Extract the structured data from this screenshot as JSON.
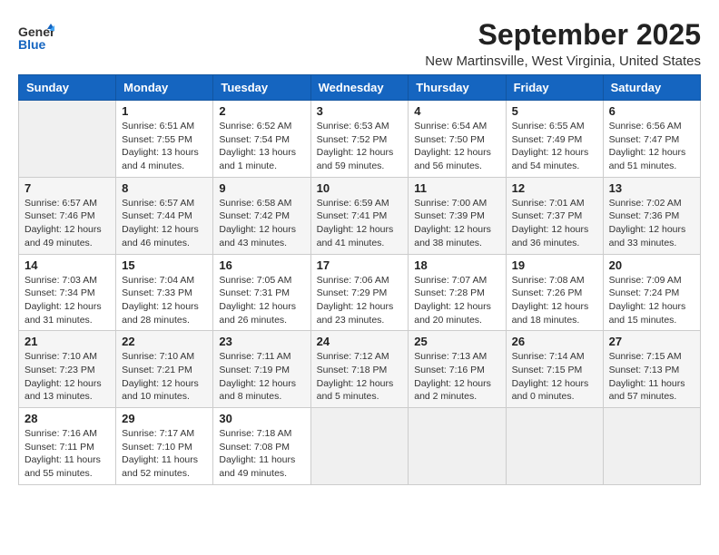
{
  "logo": {
    "text_general": "General",
    "text_blue": "Blue"
  },
  "title": "September 2025",
  "subtitle": "New Martinsville, West Virginia, United States",
  "days_of_week": [
    "Sunday",
    "Monday",
    "Tuesday",
    "Wednesday",
    "Thursday",
    "Friday",
    "Saturday"
  ],
  "weeks": [
    [
      {
        "day": "",
        "info": ""
      },
      {
        "day": "1",
        "info": "Sunrise: 6:51 AM\nSunset: 7:55 PM\nDaylight: 13 hours\nand 4 minutes."
      },
      {
        "day": "2",
        "info": "Sunrise: 6:52 AM\nSunset: 7:54 PM\nDaylight: 13 hours\nand 1 minute."
      },
      {
        "day": "3",
        "info": "Sunrise: 6:53 AM\nSunset: 7:52 PM\nDaylight: 12 hours\nand 59 minutes."
      },
      {
        "day": "4",
        "info": "Sunrise: 6:54 AM\nSunset: 7:50 PM\nDaylight: 12 hours\nand 56 minutes."
      },
      {
        "day": "5",
        "info": "Sunrise: 6:55 AM\nSunset: 7:49 PM\nDaylight: 12 hours\nand 54 minutes."
      },
      {
        "day": "6",
        "info": "Sunrise: 6:56 AM\nSunset: 7:47 PM\nDaylight: 12 hours\nand 51 minutes."
      }
    ],
    [
      {
        "day": "7",
        "info": "Sunrise: 6:57 AM\nSunset: 7:46 PM\nDaylight: 12 hours\nand 49 minutes."
      },
      {
        "day": "8",
        "info": "Sunrise: 6:57 AM\nSunset: 7:44 PM\nDaylight: 12 hours\nand 46 minutes."
      },
      {
        "day": "9",
        "info": "Sunrise: 6:58 AM\nSunset: 7:42 PM\nDaylight: 12 hours\nand 43 minutes."
      },
      {
        "day": "10",
        "info": "Sunrise: 6:59 AM\nSunset: 7:41 PM\nDaylight: 12 hours\nand 41 minutes."
      },
      {
        "day": "11",
        "info": "Sunrise: 7:00 AM\nSunset: 7:39 PM\nDaylight: 12 hours\nand 38 minutes."
      },
      {
        "day": "12",
        "info": "Sunrise: 7:01 AM\nSunset: 7:37 PM\nDaylight: 12 hours\nand 36 minutes."
      },
      {
        "day": "13",
        "info": "Sunrise: 7:02 AM\nSunset: 7:36 PM\nDaylight: 12 hours\nand 33 minutes."
      }
    ],
    [
      {
        "day": "14",
        "info": "Sunrise: 7:03 AM\nSunset: 7:34 PM\nDaylight: 12 hours\nand 31 minutes."
      },
      {
        "day": "15",
        "info": "Sunrise: 7:04 AM\nSunset: 7:33 PM\nDaylight: 12 hours\nand 28 minutes."
      },
      {
        "day": "16",
        "info": "Sunrise: 7:05 AM\nSunset: 7:31 PM\nDaylight: 12 hours\nand 26 minutes."
      },
      {
        "day": "17",
        "info": "Sunrise: 7:06 AM\nSunset: 7:29 PM\nDaylight: 12 hours\nand 23 minutes."
      },
      {
        "day": "18",
        "info": "Sunrise: 7:07 AM\nSunset: 7:28 PM\nDaylight: 12 hours\nand 20 minutes."
      },
      {
        "day": "19",
        "info": "Sunrise: 7:08 AM\nSunset: 7:26 PM\nDaylight: 12 hours\nand 18 minutes."
      },
      {
        "day": "20",
        "info": "Sunrise: 7:09 AM\nSunset: 7:24 PM\nDaylight: 12 hours\nand 15 minutes."
      }
    ],
    [
      {
        "day": "21",
        "info": "Sunrise: 7:10 AM\nSunset: 7:23 PM\nDaylight: 12 hours\nand 13 minutes."
      },
      {
        "day": "22",
        "info": "Sunrise: 7:10 AM\nSunset: 7:21 PM\nDaylight: 12 hours\nand 10 minutes."
      },
      {
        "day": "23",
        "info": "Sunrise: 7:11 AM\nSunset: 7:19 PM\nDaylight: 12 hours\nand 8 minutes."
      },
      {
        "day": "24",
        "info": "Sunrise: 7:12 AM\nSunset: 7:18 PM\nDaylight: 12 hours\nand 5 minutes."
      },
      {
        "day": "25",
        "info": "Sunrise: 7:13 AM\nSunset: 7:16 PM\nDaylight: 12 hours\nand 2 minutes."
      },
      {
        "day": "26",
        "info": "Sunrise: 7:14 AM\nSunset: 7:15 PM\nDaylight: 12 hours\nand 0 minutes."
      },
      {
        "day": "27",
        "info": "Sunrise: 7:15 AM\nSunset: 7:13 PM\nDaylight: 11 hours\nand 57 minutes."
      }
    ],
    [
      {
        "day": "28",
        "info": "Sunrise: 7:16 AM\nSunset: 7:11 PM\nDaylight: 11 hours\nand 55 minutes."
      },
      {
        "day": "29",
        "info": "Sunrise: 7:17 AM\nSunset: 7:10 PM\nDaylight: 11 hours\nand 52 minutes."
      },
      {
        "day": "30",
        "info": "Sunrise: 7:18 AM\nSunset: 7:08 PM\nDaylight: 11 hours\nand 49 minutes."
      },
      {
        "day": "",
        "info": ""
      },
      {
        "day": "",
        "info": ""
      },
      {
        "day": "",
        "info": ""
      },
      {
        "day": "",
        "info": ""
      }
    ]
  ]
}
